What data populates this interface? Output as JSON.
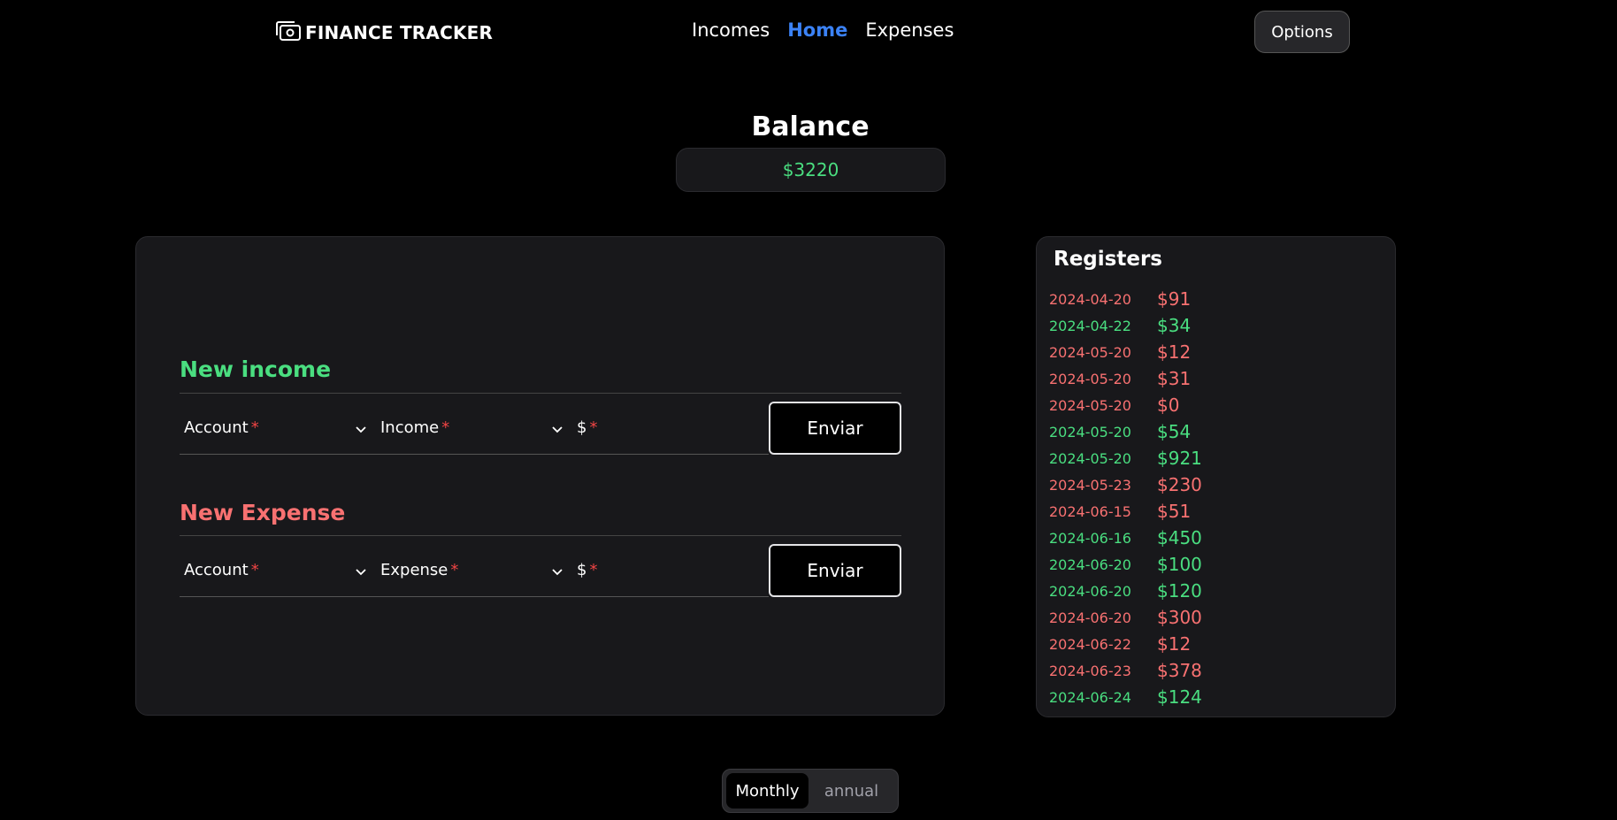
{
  "header": {
    "logo_text": "FINANCE TRACKER",
    "nav": [
      {
        "label": "Incomes",
        "active": false
      },
      {
        "label": "Home",
        "active": true
      },
      {
        "label": "Expenses",
        "active": false
      }
    ],
    "options_label": "Options"
  },
  "balance": {
    "title": "Balance",
    "value": "$3220"
  },
  "income_form": {
    "title": "New income",
    "account_label": "Account",
    "category_label": "Income",
    "amount_label": "$",
    "required_mark": "*",
    "submit_label": "Enviar"
  },
  "expense_form": {
    "title": "New Expense",
    "account_label": "Account",
    "category_label": "Expense",
    "amount_label": "$",
    "required_mark": "*",
    "submit_label": "Enviar"
  },
  "registers": {
    "title": "Registers",
    "items": [
      {
        "date": "2024-04-20",
        "amount": "$91",
        "type": "expense"
      },
      {
        "date": "2024-04-22",
        "amount": "$34",
        "type": "income"
      },
      {
        "date": "2024-05-20",
        "amount": "$12",
        "type": "expense"
      },
      {
        "date": "2024-05-20",
        "amount": "$31",
        "type": "expense"
      },
      {
        "date": "2024-05-20",
        "amount": "$0",
        "type": "expense"
      },
      {
        "date": "2024-05-20",
        "amount": "$54",
        "type": "income"
      },
      {
        "date": "2024-05-20",
        "amount": "$921",
        "type": "income"
      },
      {
        "date": "2024-05-23",
        "amount": "$230",
        "type": "expense"
      },
      {
        "date": "2024-06-15",
        "amount": "$51",
        "type": "expense"
      },
      {
        "date": "2024-06-16",
        "amount": "$450",
        "type": "income"
      },
      {
        "date": "2024-06-20",
        "amount": "$100",
        "type": "income"
      },
      {
        "date": "2024-06-20",
        "amount": "$120",
        "type": "income"
      },
      {
        "date": "2024-06-20",
        "amount": "$300",
        "type": "expense"
      },
      {
        "date": "2024-06-22",
        "amount": "$12",
        "type": "expense"
      },
      {
        "date": "2024-06-23",
        "amount": "$378",
        "type": "expense"
      },
      {
        "date": "2024-06-24",
        "amount": "$124",
        "type": "income"
      }
    ]
  },
  "period_toggle": {
    "options": [
      {
        "label": "Monthly",
        "selected": true
      },
      {
        "label": "annual",
        "selected": false
      }
    ]
  },
  "colors": {
    "income": "#4ade80",
    "expense": "#f87171",
    "active_nav": "#3b82f6",
    "required": "#ef4444"
  },
  "icons": {
    "logo": "money-bill-icon",
    "dropdown": "chevron-down-icon"
  }
}
